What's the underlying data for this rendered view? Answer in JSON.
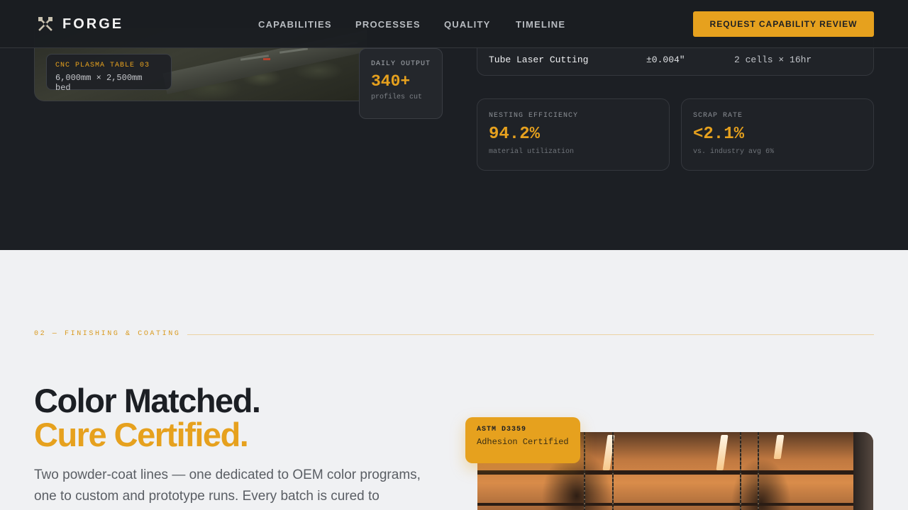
{
  "nav": {
    "brand": "FORGE",
    "links": [
      "CAPABILITIES",
      "PROCESSES",
      "QUALITY",
      "TIMELINE"
    ],
    "cta": "REQUEST CAPABILITY REVIEW"
  },
  "cutting": {
    "cnc_label_title": "CNC PLASMA TABLE 03",
    "cnc_label_spec": "6,000mm × 2,500mm bed",
    "daily_output": {
      "label": "DAILY OUTPUT",
      "value": "340+",
      "sub": "profiles cut"
    },
    "process_row": {
      "process": "Tube Laser Cutting",
      "tolerance": "±0.004\"",
      "capacity": "2 cells × 16hr"
    },
    "metrics": [
      {
        "label": "NESTING EFFICIENCY",
        "value": "94.2%",
        "sub": "material utilization"
      },
      {
        "label": "SCRAP RATE",
        "value": "<2.1%",
        "sub": "vs. industry avg 6%"
      }
    ]
  },
  "finishing": {
    "tag": "02 — FINISHING & COATING",
    "headline_1": "Color Matched.",
    "headline_2": "Cure Certified.",
    "paragraph": "Two powder-coat lines — one dedicated to OEM color programs, one to custom and prototype runs. Every batch is cured to manufacturer",
    "badge_title": "ASTM D3359",
    "badge_sub": "Adhesion Certified"
  },
  "colors": {
    "accent": "#e6a11e",
    "dark_bg": "#1c1f24",
    "light_bg": "#f0f1f3"
  }
}
